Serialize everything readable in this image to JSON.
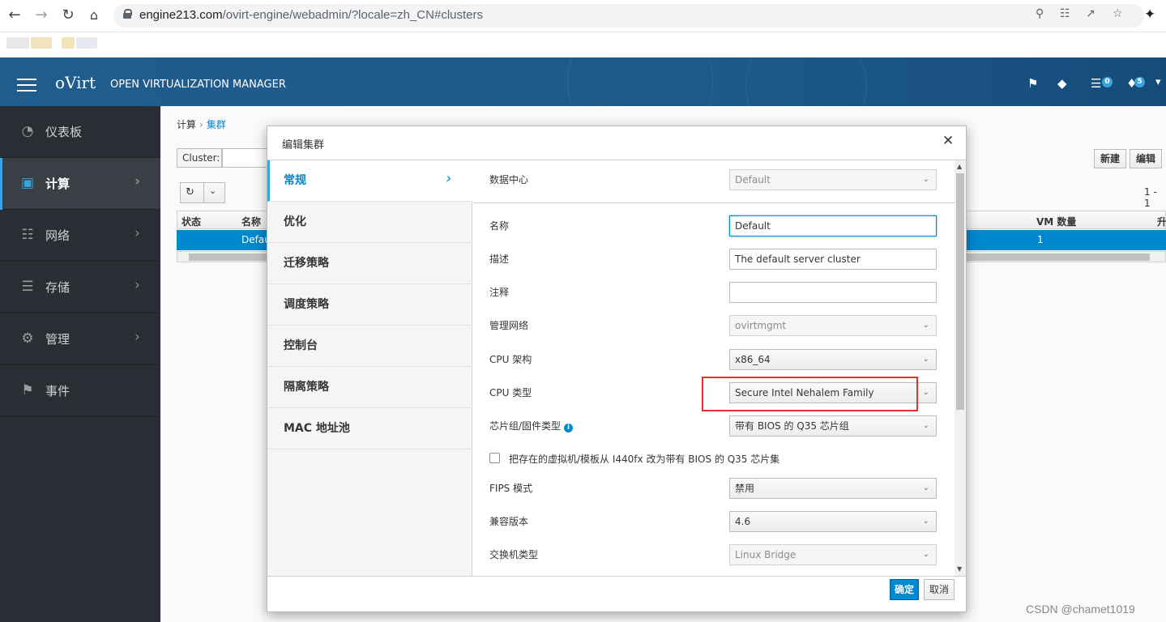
{
  "browser": {
    "url_host": "engine213.com",
    "url_path": "/ovirt-engine/webadmin/?locale=zh_CN#clusters"
  },
  "header": {
    "logo": "oVirt",
    "product_name": "OPEN VIRTUALIZATION MANAGER",
    "tasks_badge": "0",
    "events_badge": "5"
  },
  "sidebar": {
    "items": [
      {
        "label": "仪表板",
        "icon": "dashboard-icon"
      },
      {
        "label": "计算",
        "icon": "cpu-icon"
      },
      {
        "label": "网络",
        "icon": "network-icon"
      },
      {
        "label": "存储",
        "icon": "storage-icon"
      },
      {
        "label": "管理",
        "icon": "gear-icon"
      },
      {
        "label": "事件",
        "icon": "flag-icon"
      }
    ]
  },
  "main": {
    "breadcrumb": {
      "parent": "计算",
      "current": "集群"
    },
    "search_label": "Cluster:",
    "buttons": {
      "new": "新建",
      "edit": "编辑"
    },
    "pager": "1 - 1",
    "table": {
      "columns": [
        "状态",
        "名称",
        "VM 数量",
        "升"
      ],
      "row": {
        "name": "Defau",
        "vm_count": "1"
      }
    }
  },
  "modal": {
    "title": "编辑集群",
    "tabs": [
      "常规",
      "优化",
      "迁移策略",
      "调度策略",
      "控制台",
      "隔离策略",
      "MAC 地址池"
    ],
    "fields": {
      "datacenter_label": "数据中心",
      "datacenter_value": "Default",
      "name_label": "名称",
      "name_value": "Default",
      "description_label": "描述",
      "description_value": "The default server cluster",
      "comment_label": "注释",
      "comment_value": "",
      "mgmt_network_label": "管理网络",
      "mgmt_network_value": "ovirtmgmt",
      "cpu_arch_label": "CPU 架构",
      "cpu_arch_value": "x86_64",
      "cpu_type_label": "CPU 类型",
      "cpu_type_value": "Secure Intel Nehalem Family",
      "chipset_label": "芯片组/固件类型",
      "chipset_value": "带有 BIOS 的 Q35 芯片组",
      "change_chipset_label": "把存在的虚拟机/模板从 I440fx 改为带有 BIOS 的 Q35 芯片集",
      "fips_label": "FIPS 模式",
      "fips_value": "禁用",
      "compat_label": "兼容版本",
      "compat_value": "4.6",
      "switch_label": "交换机类型",
      "switch_value": "Linux Bridge"
    },
    "ok_label": "确定",
    "cancel_label": "取消"
  },
  "watermark": "CSDN @chamet1019",
  "colors": {
    "accent": "#0088ce",
    "header": "#1e5b8f",
    "sidebar": "#292e34",
    "highlight": "#e6312f"
  }
}
